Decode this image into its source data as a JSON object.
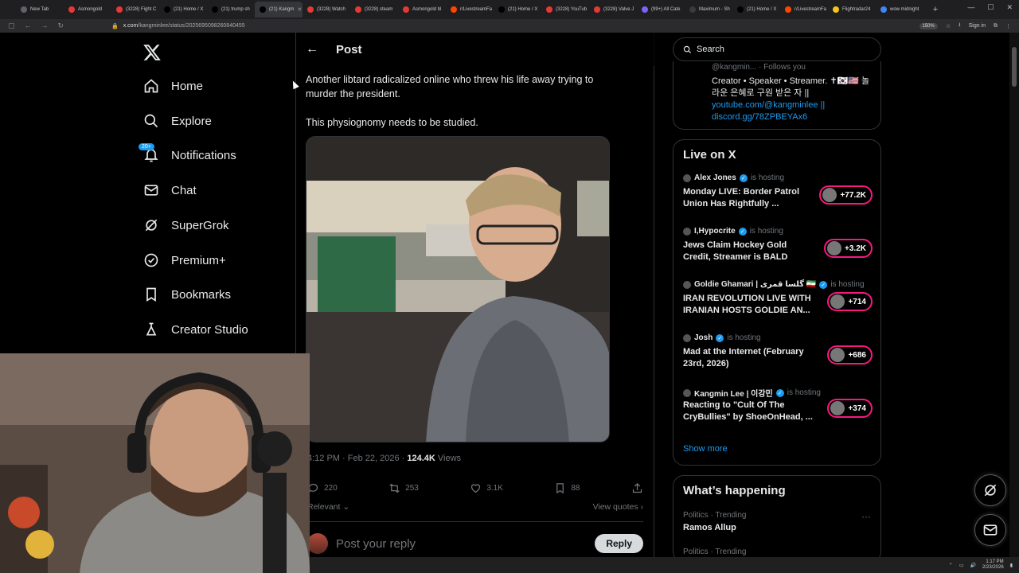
{
  "browser": {
    "tabs": [
      {
        "label": "New Tab",
        "color": "#5f6368"
      },
      {
        "label": "Asmongold",
        "color": "#e53935"
      },
      {
        "label": "(3228) Fight C",
        "color": "#e53935"
      },
      {
        "label": "(21) Home / X",
        "color": "#000000"
      },
      {
        "label": "(21) trump sh",
        "color": "#000000"
      },
      {
        "label": "(21) Kangm",
        "color": "#000000",
        "active": true
      },
      {
        "label": "(3228) Watch",
        "color": "#e53935"
      },
      {
        "label": "(3228) steam",
        "color": "#e53935"
      },
      {
        "label": "Asmongold bl",
        "color": "#e53935"
      },
      {
        "label": "r/LivestreamFa",
        "color": "#ff4500"
      },
      {
        "label": "(21) Home / X",
        "color": "#000000"
      },
      {
        "label": "(3228) YouTub",
        "color": "#e53935"
      },
      {
        "label": "(3228) Valve J",
        "color": "#e53935"
      },
      {
        "label": "(99+) All Cate",
        "color": "#7b61ff"
      },
      {
        "label": "Maximum - Sh",
        "color": "#3a3a3a"
      },
      {
        "label": "(21) Home / X",
        "color": "#000000"
      },
      {
        "label": "r/LivestreamFa",
        "color": "#ff4500"
      },
      {
        "label": "Flightradar24",
        "color": "#f5c518"
      },
      {
        "label": "wow midnight",
        "color": "#4285f4"
      }
    ],
    "url_host": "x.com",
    "url_path": "/kangminlee/status/2025695098260840455",
    "zoom": "150%",
    "signin_label": "Sign in"
  },
  "nav": {
    "items": [
      {
        "label": "Home",
        "icon": "home-icon"
      },
      {
        "label": "Explore",
        "icon": "search-icon"
      },
      {
        "label": "Notifications",
        "icon": "bell-icon",
        "badge": "20+"
      },
      {
        "label": "Chat",
        "icon": "mail-icon"
      },
      {
        "label": "SuperGrok",
        "icon": "grok-icon"
      },
      {
        "label": "Premium+",
        "icon": "verified-icon"
      },
      {
        "label": "Bookmarks",
        "icon": "bookmark-icon"
      },
      {
        "label": "Creator Studio",
        "icon": "creator-studio-icon"
      }
    ]
  },
  "post": {
    "header_title": "Post",
    "text_line1": "Another libtard radicalized online who threw his life away trying to murder the president.",
    "text_line2": "This physiognomy needs to be studied.",
    "time": "4:12 PM · Feb 22, 2026",
    "views_count": "124.4K",
    "views_label": "Views",
    "replies": "220",
    "reposts": "253",
    "likes": "3.1K",
    "bookmarks": "88",
    "sort_label": "Relevant",
    "view_quotes_label": "View quotes",
    "reply_placeholder": "Post your reply",
    "reply_button": "Reply"
  },
  "right": {
    "search_placeholder": "Search",
    "profile": {
      "handle": "@kangmin... · Follows you",
      "bio": "Creator • Speaker • Streamer. ✝🇰🇷🇺🇸 놀라운 은혜로 구원 받은 자 ||",
      "link1": "youtube.com/@kangminlee ||",
      "link2": "discord.gg/78ZPBEYAx6"
    },
    "live": {
      "title": "Live on X",
      "hosting_label": "is hosting",
      "items": [
        {
          "host": "Alex Jones",
          "title": "Monday LIVE: Border Patrol Union Has Rightfully ...",
          "count": "+77.2K"
        },
        {
          "host": "I,Hypocrite",
          "title": "Jews Claim Hockey Gold Credit, Streamer is BALD",
          "count": "+3.2K"
        },
        {
          "host": "Goldie Ghamari | گلسا قمری 🇮🇷",
          "title": "IRAN REVOLUTION LIVE WITH IRANIAN HOSTS GOLDIE AN...",
          "count": "+714"
        },
        {
          "host": "Josh",
          "title": "Mad at the Internet (February 23rd, 2026)",
          "count": "+686"
        },
        {
          "host": "Kangmin Lee | 이강민",
          "title": "Reacting to \"Cult Of The CryBullies\" by ShoeOnHead, ...",
          "count": "+374"
        }
      ],
      "show_more": "Show more"
    },
    "happening": {
      "title": "What’s happening",
      "trend_category": "Politics · Trending",
      "trend_name": "Ramos Allup",
      "trend_category2": "Politics · Trending"
    }
  },
  "taskbar": {
    "time": "1:17 PM",
    "date": "2/23/2026"
  }
}
